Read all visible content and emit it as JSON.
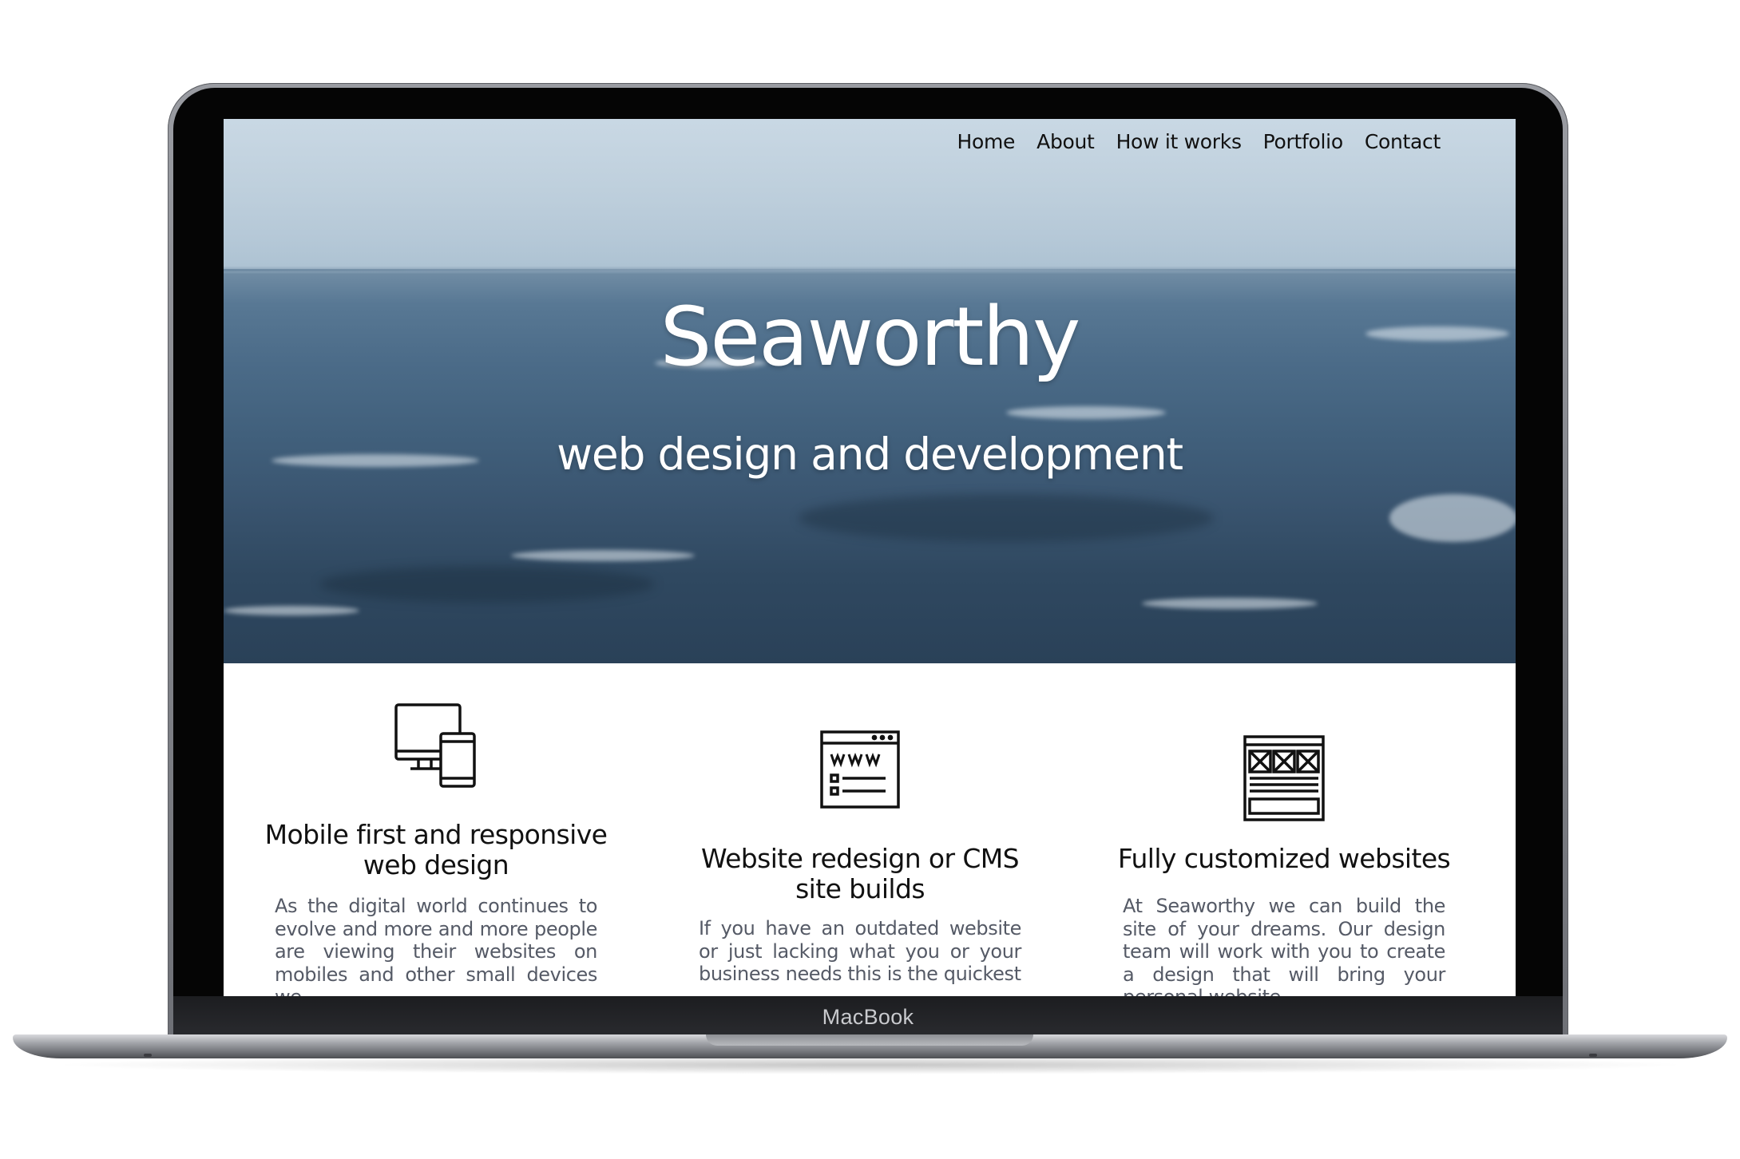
{
  "device": {
    "brand_label": "MacBook"
  },
  "nav": {
    "items": [
      {
        "label": "Home"
      },
      {
        "label": "About"
      },
      {
        "label": "How it works"
      },
      {
        "label": "Portfolio"
      },
      {
        "label": "Contact"
      }
    ]
  },
  "hero": {
    "title": "Seaworthy",
    "subtitle": "web design and development"
  },
  "features": [
    {
      "icon": "devices-icon",
      "title": "Mobile first and responsive web design",
      "text": "As the digital world continues to evolve and more and more people are viewing their websites on mobiles and other small devices we"
    },
    {
      "icon": "browser-window-icon",
      "title": "Website redesign or CMS site builds",
      "text": "If you have an outdated website or just lacking what you or your business needs this is the quickest"
    },
    {
      "icon": "wireframe-layout-icon",
      "title": "Fully customized websites",
      "text": "At Seaworthy we can build the site of your dreams. Our design team will work with you to create a design that will bring your personal website"
    }
  ]
}
